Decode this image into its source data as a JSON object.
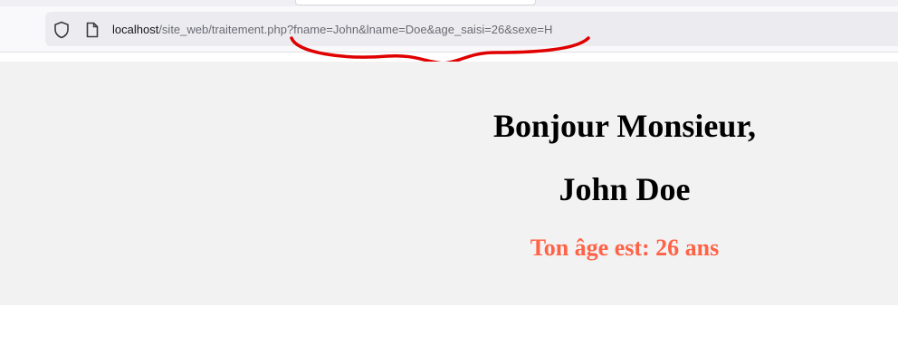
{
  "browser": {
    "url_host": "localhost",
    "url_path": "/site_web/traitement.php?fname=John&lname=Doe&age_saisi=26&sexe=H",
    "icons": [
      "shield-icon",
      "page-icon"
    ]
  },
  "page": {
    "greeting": "Bonjour Monsieur,",
    "name": "John Doe",
    "age_text": "Ton âge est: 26 ans"
  },
  "colors": {
    "age_text": "#ff6347",
    "content_bg": "#f2f2f2",
    "annotation": "#e00000"
  }
}
